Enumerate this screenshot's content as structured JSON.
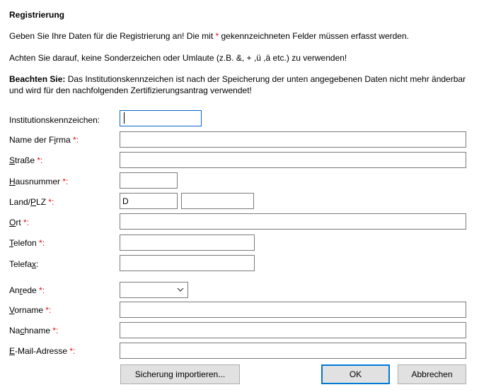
{
  "dialog": {
    "title": "Registrierung",
    "intro_pre": "Geben Sie Ihre Daten für die Registrierung an! Die mit ",
    "intro_star": "*",
    "intro_post": " gekennzeichneten Felder müssen erfasst werden.",
    "warning": "Achten Sie darauf, keine Sonderzeichen oder Umlaute (z.B. &, + ,ü ,ä etc.) zu verwenden!",
    "note_bold": "Beachten Sie:",
    "note_line1": " Das Institutionskennzeichen ist nach der Speicherung der unten angegebenen Daten nicht mehr änderbar",
    "note_line2": "und wird für den nachfolgenden Zertifizierungsantrag verwendet!"
  },
  "form": {
    "required_mark": " *:",
    "institution": {
      "label": "Institutionskennzeichen:",
      "value": ""
    },
    "company": {
      "label_pre": "Name der F",
      "label_key": "i",
      "label_post": "rma",
      "value": ""
    },
    "street": {
      "label_pre": "",
      "label_key": "S",
      "label_post": "traße",
      "value": ""
    },
    "house_number": {
      "label_pre": "",
      "label_key": "H",
      "label_post": "ausnummer",
      "value": ""
    },
    "country_zip": {
      "label_pre": "Land/",
      "label_key": "P",
      "label_post": "LZ",
      "country_value": "D",
      "zip_value": ""
    },
    "city": {
      "label_pre": "",
      "label_key": "O",
      "label_post": "rt",
      "value": ""
    },
    "phone": {
      "label_pre": "",
      "label_key": "T",
      "label_post": "elefon",
      "value": ""
    },
    "fax": {
      "label_pre": "Telefa",
      "label_key": "x",
      "label_post": ":",
      "value": ""
    },
    "salutation": {
      "label_pre": "An",
      "label_key": "r",
      "label_post": "ede",
      "value": ""
    },
    "first_name": {
      "label_pre": "",
      "label_key": "V",
      "label_post": "orname",
      "value": ""
    },
    "last_name": {
      "label_pre": "Na",
      "label_key": "c",
      "label_post": "hname",
      "value": ""
    },
    "email": {
      "label_pre": "",
      "label_key": "E",
      "label_post": "-Mail-Adresse",
      "value": ""
    }
  },
  "buttons": {
    "import": "Sicherung importieren...",
    "ok": "OK",
    "cancel": "Abbrechen"
  },
  "colors": {
    "required": "#e01010",
    "focus": "#0a64c8",
    "default_button": "#0078d7"
  }
}
